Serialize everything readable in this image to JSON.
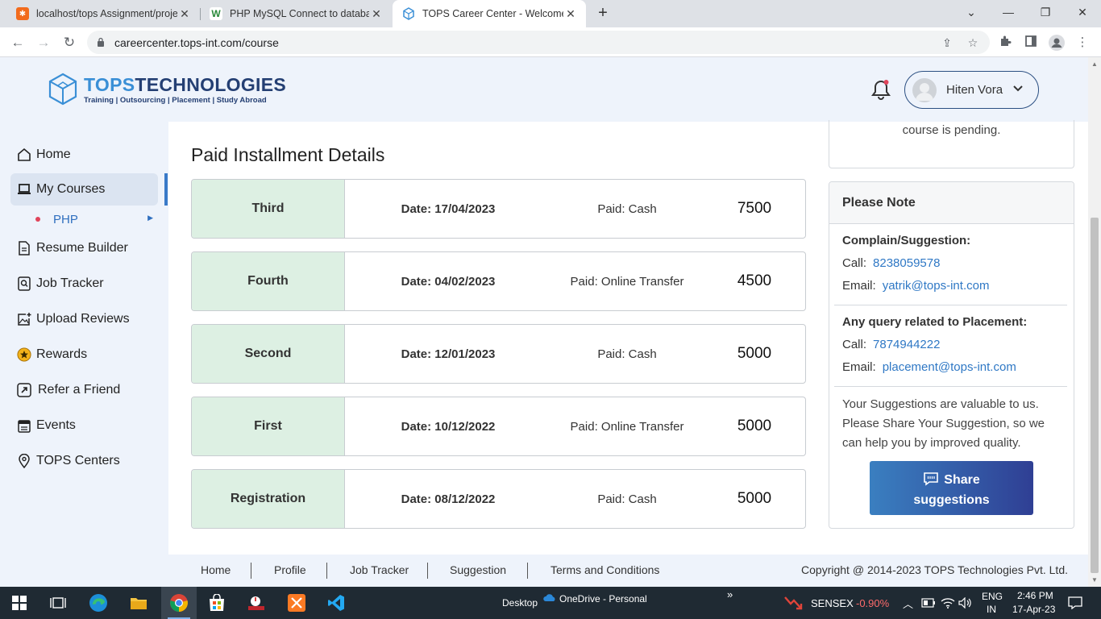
{
  "browser": {
    "tabs": [
      {
        "title": "localhost/tops Assignment/proje",
        "close": "✕"
      },
      {
        "title": "PHP MySQL Connect to database",
        "close": "✕"
      },
      {
        "title": "TOPS Career Center - Welcome t",
        "close": "✕"
      }
    ],
    "url": "careercenter.tops-int.com/course"
  },
  "header": {
    "logo_title_a": "TOPS",
    "logo_title_b": "TECHNOLOGIES",
    "logo_sub": "Training | Outsourcing | Placement | Study Abroad",
    "user_name": "Hiten Vora"
  },
  "sidebar": {
    "items": [
      {
        "label": "Home",
        "icon": "home-icon"
      },
      {
        "label": "My Courses",
        "icon": "laptop-icon"
      },
      {
        "label": "Resume Builder",
        "icon": "document-icon"
      },
      {
        "label": "Job Tracker",
        "icon": "search-tracker-icon"
      },
      {
        "label": "Upload Reviews",
        "icon": "upload-image-icon"
      },
      {
        "label": "Rewards",
        "icon": "star-coin-icon"
      },
      {
        "label": "Refer a Friend",
        "icon": "share-arrow-icon"
      },
      {
        "label": "Events",
        "icon": "calendar-icon"
      },
      {
        "label": "TOPS Centers",
        "icon": "location-pin-icon"
      }
    ],
    "sub_item": "PHP"
  },
  "main": {
    "pending_text": "course is pending.",
    "section_title": "Paid Installment Details",
    "installments": [
      {
        "label": "Third",
        "date": "Date: 17/04/2023",
        "paid": "Paid: Cash",
        "amount": "7500"
      },
      {
        "label": "Fourth",
        "date": "Date: 04/02/2023",
        "paid": "Paid: Online Transfer",
        "amount": "4500"
      },
      {
        "label": "Second",
        "date": "Date: 12/01/2023",
        "paid": "Paid: Cash",
        "amount": "5000"
      },
      {
        "label": "First",
        "date": "Date: 10/12/2022",
        "paid": "Paid: Online Transfer",
        "amount": "5000"
      },
      {
        "label": "Registration",
        "date": "Date: 08/12/2022",
        "paid": "Paid: Cash",
        "amount": "5000"
      }
    ]
  },
  "note": {
    "title": "Please Note",
    "complain_heading": "Complain/Suggestion:",
    "call_label": "Call:",
    "email_label": "Email:",
    "complain_phone": "8238059578",
    "complain_email": "yatrik@tops-int.com",
    "placement_heading": "Any query related to Placement:",
    "placement_phone": "7874944222",
    "placement_email": "placement@tops-int.com",
    "suggestion_text": "Your Suggestions are valuable to us. Please Share Your Suggestion, so we can help you by improved quality.",
    "share_line1": "Share",
    "share_line2": "suggestions"
  },
  "footer": {
    "links": [
      "Home",
      "Profile",
      "Job Tracker",
      "Suggestion",
      "Terms and Conditions"
    ],
    "copyright": "Copyright @ 2014-2023 TOPS Technologies Pvt. Ltd."
  },
  "taskbar": {
    "desktop_label": "Desktop",
    "onedrive_label": "OneDrive - Personal",
    "sensex_label": "SENSEX",
    "sensex_change": "-0.90%",
    "lang_line1": "ENG",
    "lang_line2": "IN",
    "time": "2:46 PM",
    "date": "17-Apr-23"
  },
  "colors": {
    "brand_blue": "#3a8fd6",
    "brand_navy": "#243f73",
    "installment_label_bg": "#ddf0e3",
    "link": "#2f78c5",
    "sensex_negative": "#ff6b6b"
  }
}
